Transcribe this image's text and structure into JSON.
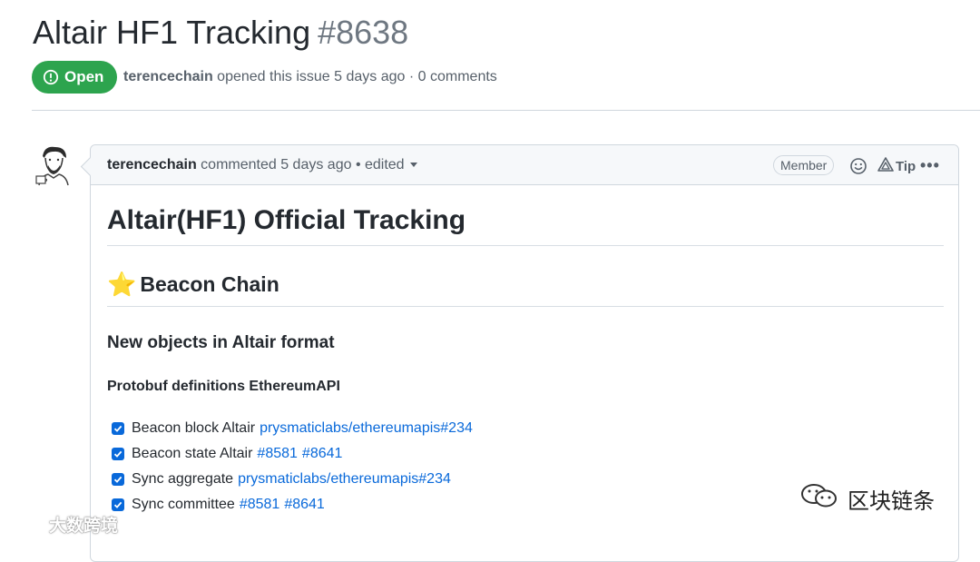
{
  "issue": {
    "title": "Altair HF1 Tracking",
    "number": "#8638",
    "state": "Open",
    "author": "terencechain",
    "meta": "opened this issue 5 days ago · 0 comments"
  },
  "comment": {
    "author": "terencechain",
    "meta": "commented 5 days ago • edited",
    "role_badge": "Member",
    "tip_label": "Tip",
    "icons": [
      "smiley-icon",
      "tip-icon",
      "kebab-horizontal-icon",
      "caret-down-icon"
    ]
  },
  "body": {
    "h1": "Altair(HF1) Official Tracking",
    "h2_emoji": "⭐",
    "h2": "Beacon Chain",
    "h3": "New objects in Altair format",
    "h4": "Protobuf definitions EthereumAPI",
    "tasks": [
      {
        "text": "Beacon block Altair",
        "links": [
          "prysmaticlabs/ethereumapis#234"
        ],
        "checked": true
      },
      {
        "text": "Beacon state Altair",
        "links": [
          "#8581",
          "#8641"
        ],
        "checked": true
      },
      {
        "text": "Sync aggregate",
        "links": [
          "prysmaticlabs/ethereumapis#234"
        ],
        "checked": true
      },
      {
        "text": "Sync committee",
        "links": [
          "#8581",
          "#8641"
        ],
        "checked": true
      }
    ]
  },
  "watermarks": {
    "left": "大数跨境",
    "right": "区块链条"
  },
  "colors": {
    "open_green": "#2da44e",
    "link_blue": "#0969da",
    "border": "#d0d7de"
  }
}
